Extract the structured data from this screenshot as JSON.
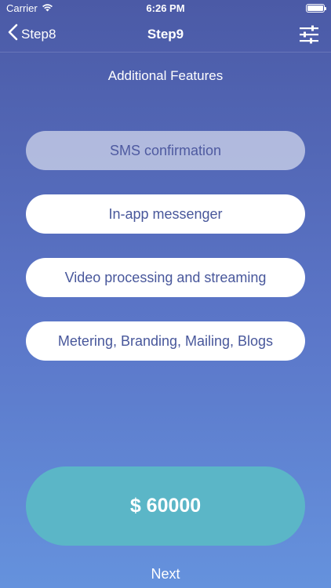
{
  "status_bar": {
    "carrier": "Carrier",
    "time": "6:26 PM"
  },
  "nav": {
    "back_label": "Step8",
    "title": "Step9",
    "settings_icon": "sliders-icon"
  },
  "section_title": "Additional Features",
  "features": [
    {
      "label": "SMS confirmation",
      "selected": true
    },
    {
      "label": "In-app messenger",
      "selected": false
    },
    {
      "label": "Video processing and streaming",
      "selected": false
    },
    {
      "label": "Metering, Branding, Mailing, Blogs",
      "selected": false
    }
  ],
  "price": "$ 60000",
  "next_label": "Next",
  "colors": {
    "background_top": "#4b5aa6",
    "background_bottom": "#6592dd",
    "feature_text": "#48579b",
    "price_button": "#5bb6c7"
  }
}
